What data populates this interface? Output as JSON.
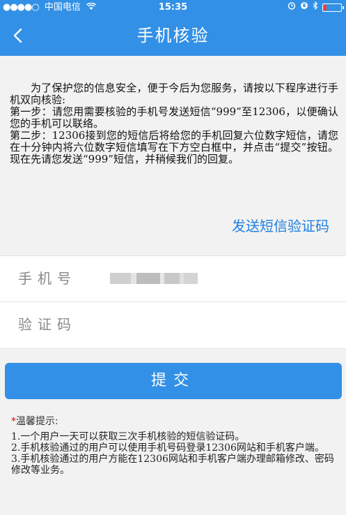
{
  "status_bar": {
    "signal": "●●●●○",
    "carrier": "中国电信",
    "wifi": "wifi-icon",
    "time": "15:35",
    "icons": [
      "alarm-icon",
      "orientation-lock-icon",
      "bluetooth-icon",
      "battery-low-icon"
    ],
    "battery_level": 0.15,
    "battery_color": "#ff3b30"
  },
  "nav": {
    "title": "手机核验",
    "back_icon": "chevron-left-icon",
    "color": "#3290e6"
  },
  "intro": {
    "paragraph1": "为了保护您的信息安全，便于今后为您服务，请按以下程序进行手机双向核验:",
    "step1": "第一步：请您用需要核验的手机号发送短信“999”至12306，以便确认您的手机可以联络。",
    "step2": "第二步：12306接到您的短信后将给您的手机回复六位数字短信，请您在十分钟内将六位数字短信填写在下方空白框中，并点击“提交”按钮。 现在先请您发送“999”短信，并稍候我们的回复。"
  },
  "send_code_link": "发送短信验证码",
  "form": {
    "phone_label": "手机号",
    "code_label": "验证码",
    "code_value": ""
  },
  "submit_label": "提交",
  "tips": {
    "star": "*",
    "title": "温馨提示:",
    "items": [
      "1.一个用户一天可以获取三次手机核验的短信验证码。",
      "2.手机核验通过的用户可以使用手机号码登录12306网站和手机客户端。",
      "3.手机核验通过的用户方能在12306网站和手机客户端办理邮箱修改、密码修改等业务。"
    ]
  }
}
